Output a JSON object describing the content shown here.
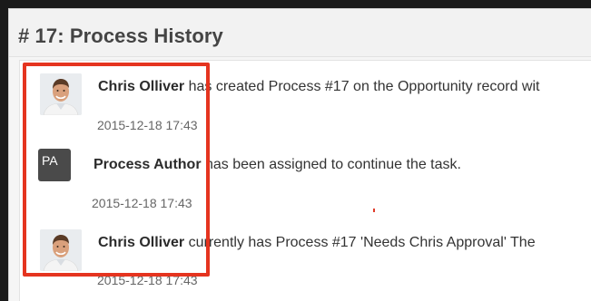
{
  "dialog": {
    "title": "# 17: Process History"
  },
  "entries": [
    {
      "avatar_type": "photo",
      "author": "Chris Olliver",
      "text": " has created Process #17 on the Opportunity record wit",
      "timestamp": "2015-12-18 17:43"
    },
    {
      "avatar_type": "initials",
      "avatar_initials": "PA",
      "author": "Process Author",
      "text": " has been assigned to continue the task.",
      "timestamp": "2015-12-18 17:43"
    },
    {
      "avatar_type": "photo",
      "author": "Chris Olliver",
      "text": " currently has Process #17 'Needs Chris Approval' The",
      "timestamp": "2015-12-18 17:43"
    }
  ],
  "colors": {
    "highlight_border": "#e5341f",
    "initials_avatar_bg": "#4a4a4a"
  }
}
